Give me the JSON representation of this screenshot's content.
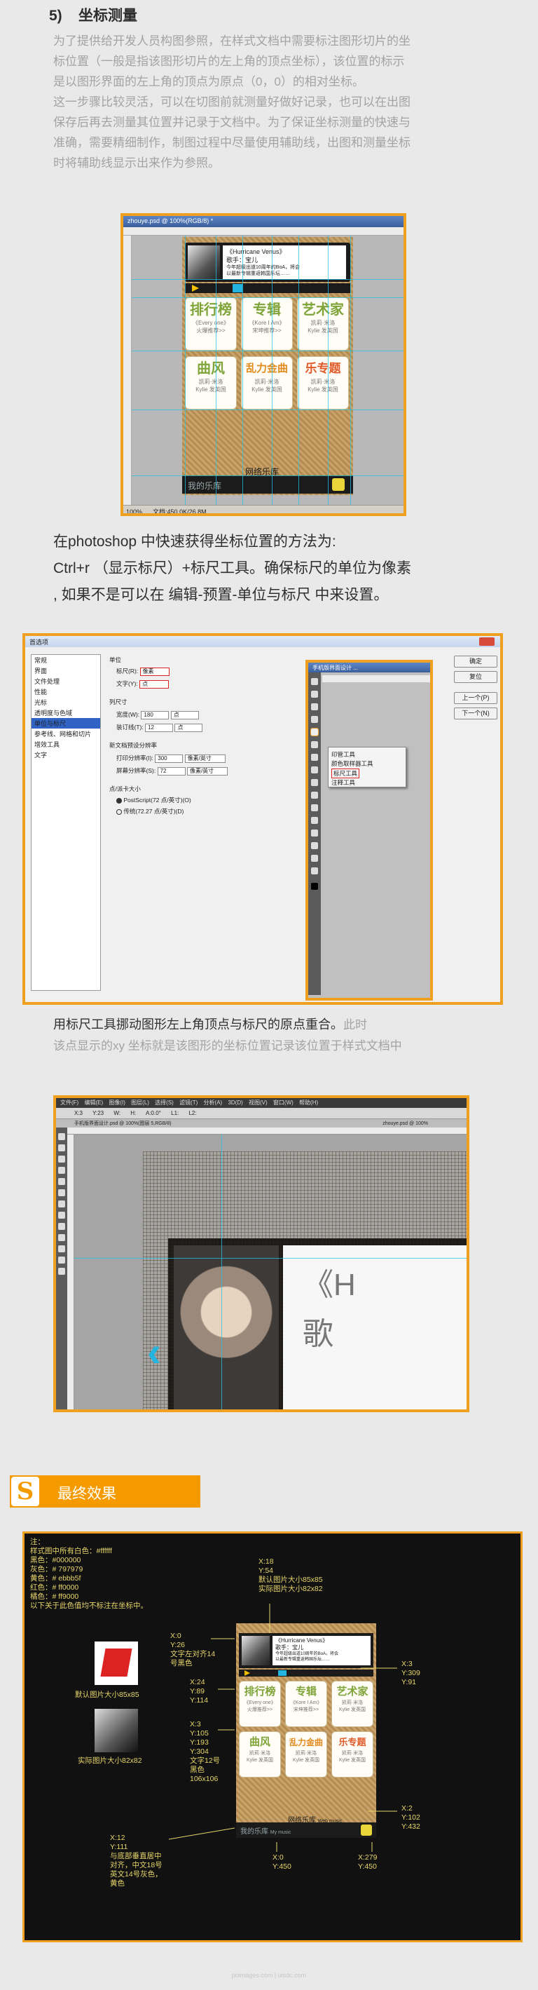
{
  "section": {
    "number": "5)",
    "title": "坐标测量"
  },
  "intro_lines": [
    "为了提供给开发人员构图参照，在样式文档中需要标注图形切片的坐",
    "标位置（一般是指该图形切片的左上角的顶点坐标），该位置的标示",
    "是以图形界面的左上角的顶点为原点（0，0）的相对坐标。",
    "这一步骤比较灵活，可以在切图前就测量好做好记录，也可以在出图",
    "保存后再去测量其位置并记录于文档中。为了保证坐标测量的快速与",
    "准确，需要精细制作，制图过程中尽量使用辅助线，出图和测量坐标",
    "时将辅助线显示出来作为参照。"
  ],
  "shot1": {
    "window_title": "zhouye.psd @ 100%(RGB/8) *",
    "song_title": "《Hurricane Venus》",
    "singer": "歌手：宝儿",
    "desc_line1": "今年超级出道10周年的BoA，将会",
    "desc_line2": "以最新专辑重返韩国乐坛……",
    "tiles": [
      {
        "big": "排行榜",
        "l1": "《Every one》",
        "l2": "火爆推荐>>"
      },
      {
        "big": "专辑",
        "l1": "《Kore I Am》",
        "l2": "宋坤推荐>>"
      },
      {
        "big": "艺术家",
        "l1": "凯莉·米洛",
        "l2": "Kylie 发英国"
      },
      {
        "big": "曲风",
        "l1": "凯莉·米洛",
        "l2": "Kylie 发英国"
      },
      {
        "big": "乱力金曲",
        "l1": "凯莉·米洛",
        "l2": "Kylie 发英国"
      },
      {
        "big": "乐专题",
        "l1": "凯莉·米洛",
        "l2": "Kylie 发英国"
      }
    ],
    "net_label": "网络乐库",
    "my_label": "我的乐库",
    "status": "100%",
    "docsize": "文档:450.0K/26.8M"
  },
  "mid_lines": [
    "在photoshop 中快速获得坐标位置的方法为:",
    "Ctrl+r （显示标尺）+标尺工具。确保标尺的单位为像素",
    ", 如果不是可以在 编辑-预置-单位与标尺 中来设置。"
  ],
  "shot2": {
    "dialog_title": "首选项",
    "list": [
      "常规",
      "界面",
      "文件处理",
      "性能",
      "光标",
      "透明度与色域",
      "单位与标尺",
      "参考线、网格和切片",
      "增效工具",
      "文字"
    ],
    "selected_index": 6,
    "units_group": "单位",
    "ruler_label": "标尺(R):",
    "ruler_value": "像素",
    "type_label": "文字(Y):",
    "type_value": "点",
    "col_group": "列尺寸",
    "width_label": "宽度(W):",
    "width_value": "180",
    "width_unit": "点",
    "gutter_label": "装订线(T):",
    "gutter_value": "12",
    "gutter_unit": "点",
    "res_group": "新文档预设分辨率",
    "print_label": "打印分辨率(I):",
    "print_value": "300",
    "print_unit": "像素/英寸",
    "screen_label": "屏幕分辨率(S):",
    "screen_value": "72",
    "screen_unit": "像素/英寸",
    "pt_group": "点/派卡大小",
    "pt_option1": "PostScript(72 点/英寸)(O)",
    "pt_option2": "传统(72.27 点/英寸)(D)",
    "buttons": [
      "确定",
      "复位",
      "上一个(P)",
      "下一个(N)"
    ],
    "ps_window_title": "手机版界面设计 ...",
    "tool_menu": [
      "印管工具",
      "颜色取样器工具",
      "标尺工具",
      "注释工具"
    ],
    "tool_menu_keys": [
      "I",
      "I",
      "I",
      "I"
    ]
  },
  "caption3": {
    "dark": "用标尺工具挪动图形左上角顶点与标尺的原点重合。",
    "light_tail": "此时",
    "line2": "该点显示的xy 坐标就是该图形的坐标位置记录该位置于样式文档中"
  },
  "shot3": {
    "menu": [
      "文件(F)",
      "编辑(E)",
      "图像(I)",
      "图层(L)",
      "选择(S)",
      "滤镜(T)",
      "分析(A)",
      "3D(D)",
      "视图(V)",
      "窗口(W)",
      "帮助(H)"
    ],
    "opts": [
      "X:3",
      "Y:23",
      "W:",
      "H:",
      "A:0.0°",
      "L1:",
      "L2:"
    ],
    "tab1": "手机版界面设计.psd @ 100%(图层 5,RGB/8)",
    "tab2": "zhouye.psd @ 100%",
    "big_text": "《H",
    "big_text2": "歌",
    "arrow": "‹"
  },
  "final": {
    "badge_letter": "S",
    "title": "最终效果"
  },
  "notes": {
    "note_block": "注：\n样式图中所有白色：#ffffff\n黑色：#000000\n灰色：# 797979\n黄色：# ebbb5f\n红色：# ff0000\n橘色：# ff9000\n以下关于此色值均不标注在坐标中。",
    "default_icon_caption": "默认图片大小85x85",
    "actual_icon_caption": "实际图片大小82x82",
    "a_top": "X:18\nY:54\n默认图片大小85x85\n实际图片大小82x82",
    "a_left1": "X:0\nY:26\n文字左对齐14\n号黑色",
    "a_left2": "X:24\nY:89\nY:114",
    "a_left3": "X:3\nY:105\nY:193\nY:304\n文字12号\n黑色\n106x106",
    "a_left4": "X:12\nY:111\n与底部垂直居中\n对齐，中文18号\n英文14号灰色，\n黄色",
    "a_bottom": "X:0\nY:450",
    "a_bottom2": "X:279\nY:450",
    "a_right1": "X:3\nY:309\nY:91",
    "a_right2": "X:2\nY:102\nY:432"
  },
  "phone2": {
    "song_title": "《Hurricane Venus》",
    "singer": "歌手：宝儿",
    "desc_line1": "今年超级出道10周年的BoA，将会",
    "desc_line2": "以最新专辑重返韩国乐坛……",
    "tiles": [
      {
        "big": "排行榜",
        "l1": "《Every one》",
        "l2": "火爆推荐>>"
      },
      {
        "big": "专辑",
        "l1": "《Kore I Am》",
        "l2": "宋坤推荐>>"
      },
      {
        "big": "艺术家",
        "l1": "凯莉·米洛",
        "l2": "Kylie 发英国"
      },
      {
        "big": "曲风",
        "l1": "凯莉·米洛",
        "l2": "Kylie 发英国"
      },
      {
        "big": "乱力金曲",
        "l1": "凯莉·米洛",
        "l2": "Kylie 发英国"
      },
      {
        "big": "乐专题",
        "l1": "凯莉·米洛",
        "l2": "Kylie 发英国"
      }
    ],
    "net_label": "网络乐库",
    "net_sub": "Web music",
    "my_label": "我的乐库",
    "my_sub": "My music"
  },
  "footer": "poimages.com | uisdc.com",
  "colors": {
    "accent_orange": "#f0a020",
    "tile_red": "#e05a2a",
    "tile_green": "#7ea43a",
    "tile_orange": "#e28a1c",
    "annotation_yellow": "#e8d66a",
    "guide_cyan": "#21c4e8"
  }
}
